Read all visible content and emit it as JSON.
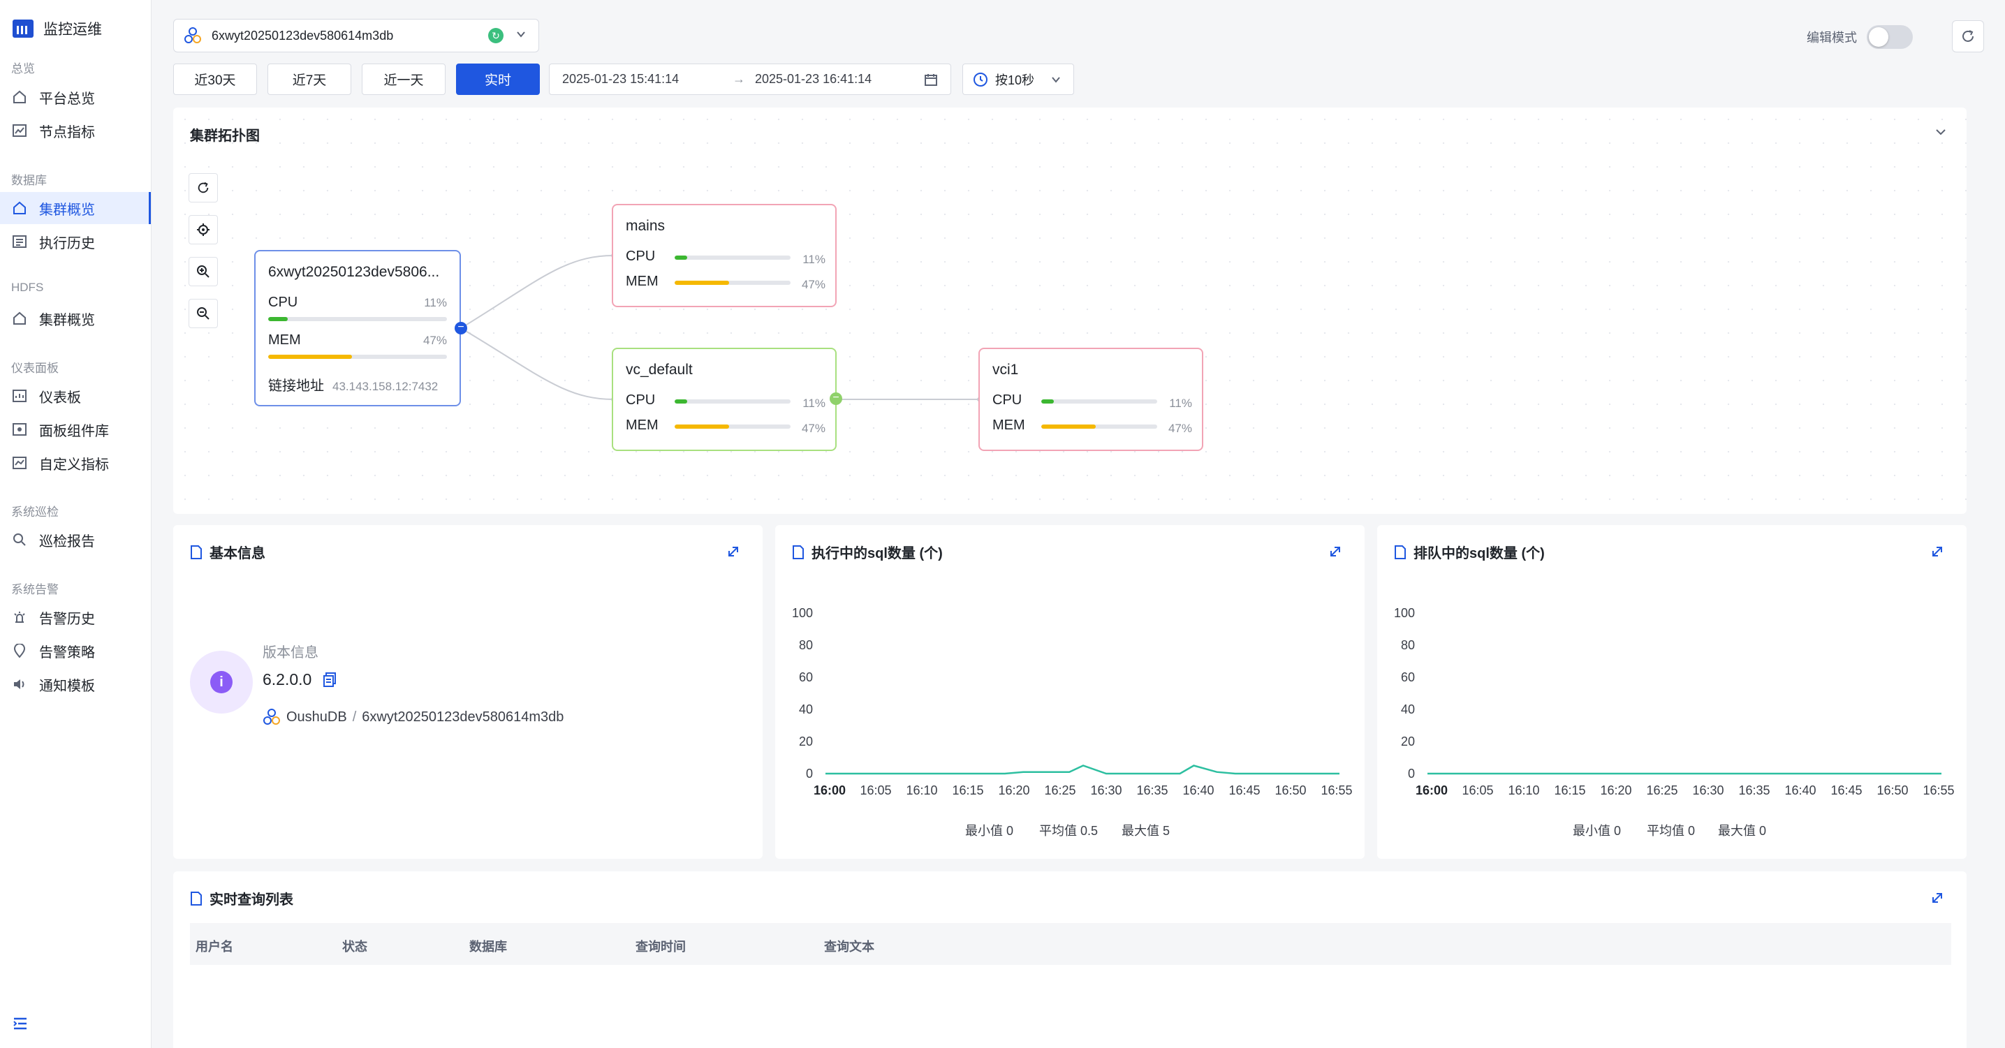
{
  "sidebar": {
    "brand": "监控运维",
    "groups": {
      "overview": "总览",
      "database": "数据库",
      "hdfs": "HDFS",
      "dashboard": "仪表面板",
      "inspection": "系统巡检",
      "alert": "系统告警"
    },
    "items": {
      "platform_overview": "平台总览",
      "node_metrics": "节点指标",
      "cluster_overview": "集群概览",
      "exec_history": "执行历史",
      "hdfs_cluster": "集群概览",
      "dashboard": "仪表板",
      "widget_library": "面板组件库",
      "custom_metrics": "自定义指标",
      "inspection_report": "巡检报告",
      "alert_history": "告警历史",
      "alert_policy": "告警策略",
      "notify_template": "通知模板"
    }
  },
  "header": {
    "db_name": "6xwyt20250123dev580614m3db",
    "edit_mode": "编辑模式"
  },
  "time_range": {
    "btn_30d": "近30天",
    "btn_7d": "近7天",
    "btn_1d": "近一天",
    "btn_realtime": "实时",
    "start": "2025-01-23 15:41:14",
    "arrow": "→",
    "end": "2025-01-23 16:41:14",
    "interval": "按10秒"
  },
  "topology": {
    "title": "集群拓扑图",
    "root": {
      "name": "6xwyt20250123dev5806...",
      "cpu_label": "CPU",
      "mem_label": "MEM",
      "cpu": 11,
      "mem": 47,
      "cpu_text": "11%",
      "mem_text": "47%",
      "link_label": "链接地址",
      "link_value": "43.143.158.12:7432"
    },
    "mains": {
      "name": "mains",
      "cpu_label": "CPU",
      "mem_label": "MEM",
      "cpu": 11,
      "mem": 47,
      "cpu_text": "11%",
      "mem_text": "47%"
    },
    "vc_default": {
      "name": "vc_default",
      "cpu_label": "CPU",
      "mem_label": "MEM",
      "cpu": 11,
      "mem": 47,
      "cpu_text": "11%",
      "mem_text": "47%"
    },
    "vci1": {
      "name": "vci1",
      "cpu_label": "CPU",
      "mem_label": "MEM",
      "cpu": 11,
      "mem": 47,
      "cpu_text": "11%",
      "mem_text": "47%"
    },
    "colors": {
      "cpu": "#3cb731",
      "mem": "#f5b800",
      "root_border": "#6d8fe8",
      "mains_border": "#f2a4b5",
      "vc_border": "#a8e07f",
      "vci_border": "#f2a4b5"
    }
  },
  "basic_info": {
    "title": "基本信息",
    "version_label": "版本信息",
    "version": "6.2.0.0",
    "product": "OushuDB",
    "sep": "/",
    "db_name": "6xwyt20250123dev580614m3db"
  },
  "running_sql": {
    "title": "执行中的sql数量 (个)",
    "min": "最小值 0",
    "avg": "平均值 0.5",
    "max": "最大值 5"
  },
  "queued_sql": {
    "title": "排队中的sql数量 (个)",
    "min": "最小值 0",
    "avg": "平均值 0",
    "max": "最大值 0"
  },
  "chart_data": [
    {
      "type": "line",
      "title": "执行中的sql数量 (个)",
      "x_ticks": [
        "16:00",
        "16:05",
        "16:10",
        "16:15",
        "16:20",
        "16:25",
        "16:30",
        "16:35",
        "16:40",
        "16:45",
        "16:50",
        "16:55"
      ],
      "y_ticks": [
        0,
        20,
        40,
        60,
        80,
        100
      ],
      "ylim": [
        0,
        100
      ],
      "grid": false,
      "series": [
        {
          "name": "",
          "color": "#2dbfa0",
          "x_minutes": [
            -3,
            19,
            21,
            26,
            27.5,
            30,
            34,
            38,
            39.5,
            42,
            44,
            45,
            59
          ],
          "values": [
            0,
            0,
            1,
            1,
            5,
            0,
            0,
            0,
            5,
            1,
            0,
            0,
            0
          ]
        }
      ]
    },
    {
      "type": "line",
      "title": "排队中的sql数量 (个)",
      "x_ticks": [
        "16:00",
        "16:05",
        "16:10",
        "16:15",
        "16:20",
        "16:25",
        "16:30",
        "16:35",
        "16:40",
        "16:45",
        "16:50",
        "16:55"
      ],
      "y_ticks": [
        0,
        20,
        40,
        60,
        80,
        100
      ],
      "ylim": [
        0,
        100
      ],
      "grid": false,
      "series": [
        {
          "name": "",
          "color": "#2dbfa0",
          "x_minutes": [
            -3,
            59
          ],
          "values": [
            0,
            0
          ]
        }
      ]
    }
  ],
  "realtime_queries": {
    "title": "实时查询列表",
    "columns": [
      "用户名",
      "状态",
      "数据库",
      "查询时间",
      "查询文本"
    ]
  }
}
